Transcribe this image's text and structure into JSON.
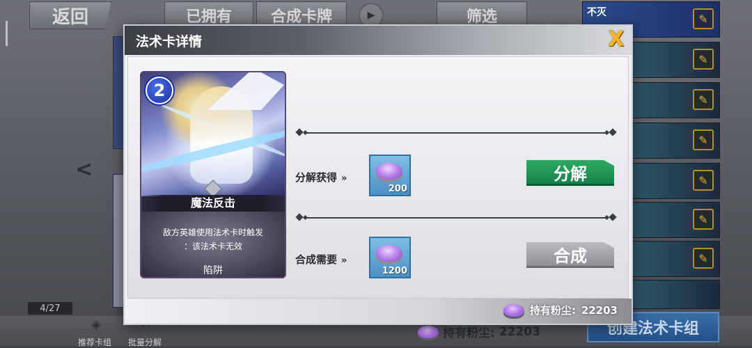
{
  "background": {
    "back_label": "返回",
    "owned_label": "已拥有",
    "compose_card_label": "合成卡牌",
    "filter_label": "筛选",
    "deck_first_label": "不灭",
    "count_label": "4/27",
    "recommend_label": "推荐卡组",
    "batch_decompose_label": "批量分解",
    "dust_label": "持有粉尘:",
    "dust_value": "22203",
    "create_deck_label": "创建法术卡组"
  },
  "modal": {
    "title": "法术卡详情",
    "close_label": "X",
    "card": {
      "cost": "2",
      "name": "魔法反击",
      "description_line1": "敌方英雄使用法术卡时触发",
      "description_line2": "：该法术卡无效",
      "type": "陷阱"
    },
    "decompose": {
      "label": "分解获得",
      "arrow": "»",
      "amount": "200",
      "button_label": "分解"
    },
    "compose": {
      "label": "合成需要",
      "arrow": "»",
      "amount": "1200",
      "button_label": "合成"
    },
    "footer": {
      "dust_label": "持有粉尘:",
      "dust_value": "22203"
    }
  },
  "colors": {
    "decompose_button": "#1f9a56",
    "compose_button_disabled": "#a3a5aa",
    "close_icon": "#f2b526",
    "cost_badge": "#2a46c8"
  },
  "icons": {
    "close": "close-icon",
    "dust": "dust-crystal-icon",
    "edit": "edit-icon",
    "arrow": "double-chevron-right-icon"
  }
}
